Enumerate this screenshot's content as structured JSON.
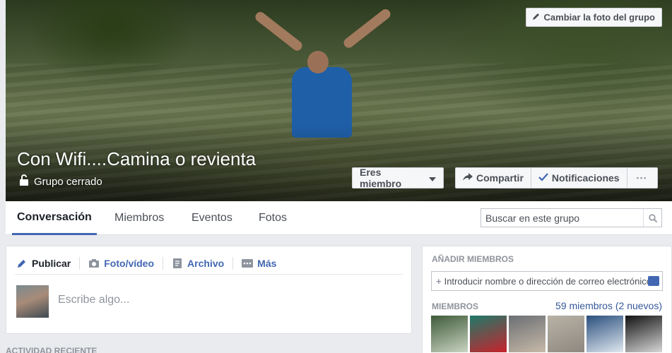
{
  "cover": {
    "change_photo_label": "Cambiar la foto del grupo",
    "group_name": "Con Wifi....Camina o revienta",
    "group_type": "Grupo cerrado"
  },
  "actions": {
    "member_label": "Eres miembro",
    "share_label": "Compartir",
    "notifications_label": "Notificaciones",
    "more_label": "•••"
  },
  "nav": {
    "tabs": [
      {
        "label": "Conversación"
      },
      {
        "label": "Miembros"
      },
      {
        "label": "Eventos"
      },
      {
        "label": "Fotos"
      }
    ],
    "search_placeholder": "Buscar en este grupo"
  },
  "composer": {
    "tabs": [
      {
        "label": "Publicar",
        "icon": "pencil-icon"
      },
      {
        "label": "Foto/vídeo",
        "icon": "camera-icon"
      },
      {
        "label": "Archivo",
        "icon": "file-icon"
      },
      {
        "label": "Más",
        "icon": "more-icon"
      }
    ],
    "placeholder": "Escribe algo..."
  },
  "recent_activity_label": "ACTIVIDAD RECIENTE",
  "sidebar": {
    "add_members_title": "AÑADIR MIEMBROS",
    "add_members_placeholder": "Introducir nombre o dirección de correo electrónico...",
    "members_title": "MIEMBROS",
    "members_count": "59 miembros (2 nuevos)",
    "member_thumbs": [
      {
        "colors": [
          "#3f5a3a",
          "#c9d4c2"
        ]
      },
      {
        "colors": [
          "#1e7a6a",
          "#c8232c"
        ]
      },
      {
        "colors": [
          "#6b6f74",
          "#c7b9a8"
        ]
      },
      {
        "colors": [
          "#b8b2a6",
          "#8e8980"
        ]
      },
      {
        "colors": [
          "#2b4f7e",
          "#dfe8ef"
        ]
      },
      {
        "colors": [
          "#121212",
          "#d7d7d7"
        ]
      }
    ]
  }
}
